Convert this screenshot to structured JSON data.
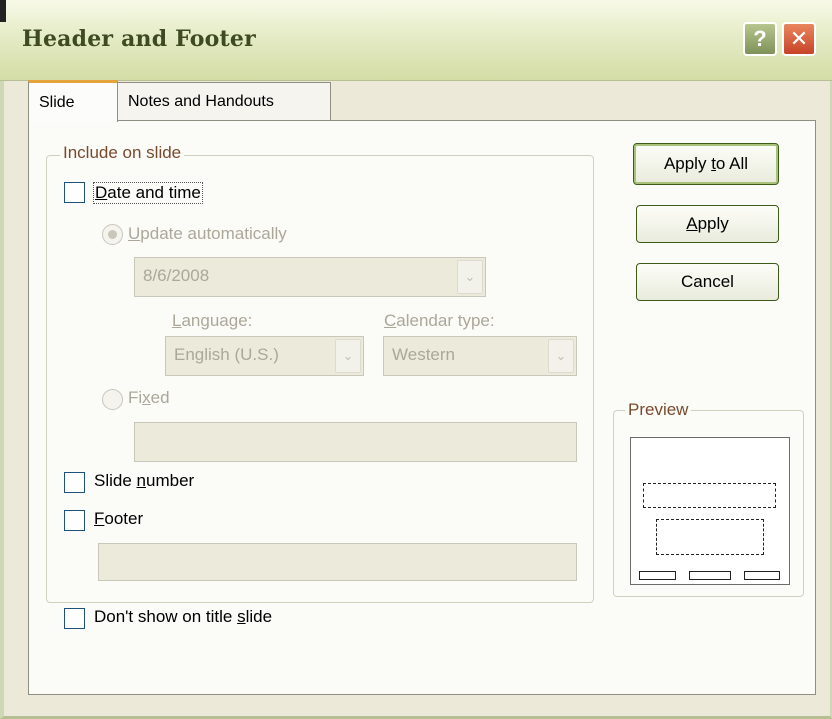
{
  "window": {
    "title": "Header and Footer",
    "help_glyph": "?",
    "close_glyph": "✕"
  },
  "tabs": [
    {
      "label": "Slide",
      "active": true
    },
    {
      "label": "Notes and Handouts",
      "active": false
    }
  ],
  "include_group": {
    "legend": "Include on slide",
    "date_time": {
      "label_mnemonic": "D",
      "label_rest": "ate and time",
      "checked": false
    },
    "update_auto": {
      "label_mnemonic": "U",
      "label_rest": "pdate automatically",
      "selected": true,
      "enabled": false
    },
    "date_value": "8/6/2008",
    "language": {
      "label_mnemonic": "L",
      "label_rest": "anguage:",
      "value": "English (U.S.)"
    },
    "calendar": {
      "label_mnemonic": "C",
      "label_rest": "alendar type:",
      "value": "Western"
    },
    "fixed": {
      "label_pre": "Fi",
      "label_mnemonic": "x",
      "label_post": "ed",
      "selected": false,
      "enabled": false,
      "value": ""
    },
    "slide_number": {
      "label_pre": "Slide ",
      "label_mnemonic": "n",
      "label_post": "umber",
      "checked": false
    },
    "footer": {
      "label_mnemonic": "F",
      "label_rest": "ooter",
      "checked": false,
      "value": ""
    }
  },
  "dont_show": {
    "label_pre": "Don't show on title ",
    "label_mnemonic": "s",
    "label_post": "lide",
    "checked": false
  },
  "buttons": {
    "apply_all": {
      "pre": "Apply ",
      "mnemonic": "t",
      "post": "o All"
    },
    "apply": {
      "mnemonic": "A",
      "post": "pply"
    },
    "cancel": "Cancel"
  },
  "preview": {
    "legend": "Preview"
  },
  "colors": {
    "titlebar": "#dfe6bd",
    "dialog_bg": "#ece9d8",
    "disabled_text": "#aca899",
    "legend_text": "#7a4a2e"
  }
}
